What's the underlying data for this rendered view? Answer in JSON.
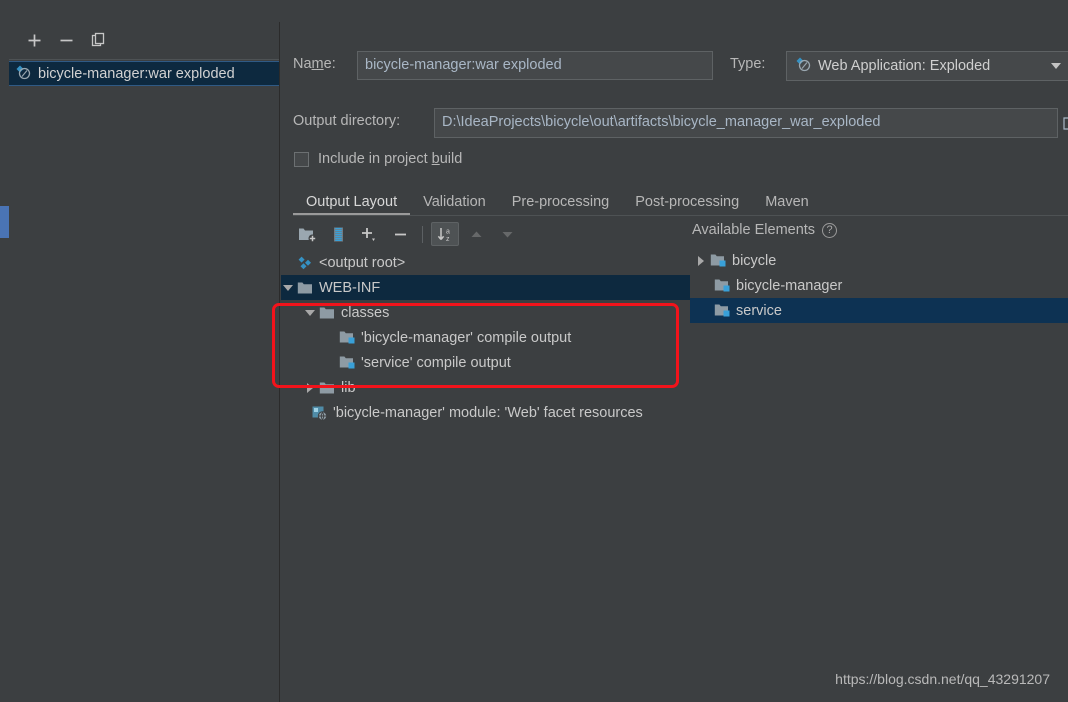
{
  "window": {
    "close_glyph": "✕"
  },
  "sidebar": {
    "toolbar": [
      {
        "name": "add-artifact-button",
        "label": "+"
      },
      {
        "name": "remove-artifact-button",
        "label": "−"
      },
      {
        "name": "copy-artifact-button",
        "label": "copy-icon"
      }
    ],
    "items": [
      {
        "label": "bicycle-manager:war exploded",
        "icon": "artifact-icon",
        "selected": true
      }
    ]
  },
  "form": {
    "name_label_pre": "Na",
    "name_label_mnemonic": "m",
    "name_label_post": "e:",
    "name_value": "bicycle-manager:war exploded",
    "type_label": "Type:",
    "type_value": "Web Application: Exploded",
    "type_icon": "artifact-icon",
    "outdir_label": "Output directory:",
    "outdir_value": "D:\\IdeaProjects\\bicycle\\out\\artifacts\\bicycle_manager_war_exploded",
    "outdir_browse_icon": "folder-open-icon",
    "include_label_pre": "Include in project ",
    "include_label_mnemonic": "b",
    "include_label_post": "uild",
    "include_checked": false
  },
  "tabs": [
    {
      "label": "Output Layout",
      "active": true
    },
    {
      "label": "Validation",
      "active": false
    },
    {
      "label": "Pre-processing",
      "active": false
    },
    {
      "label": "Post-processing",
      "active": false
    },
    {
      "label": "Maven",
      "active": false
    }
  ],
  "content_toolbar": [
    {
      "name": "create-directory-button",
      "icon": "folder-add-icon",
      "state": "normal"
    },
    {
      "name": "create-archive-button",
      "icon": "archive-icon",
      "state": "normal"
    },
    {
      "name": "add-copy-of-button",
      "icon": "plus-dropdown-icon",
      "state": "normal"
    },
    {
      "name": "remove-element-button",
      "icon": "minus-icon",
      "state": "normal"
    },
    {
      "name": "separator",
      "icon": "separator",
      "state": "separator"
    },
    {
      "name": "sort-alphabetically-button",
      "icon": "sort-az-icon",
      "state": "toggled"
    },
    {
      "name": "move-up-button",
      "icon": "arrow-up-icon",
      "state": "disabled"
    },
    {
      "name": "move-down-button",
      "icon": "arrow-down-icon",
      "state": "disabled"
    }
  ],
  "output_tree": [
    {
      "label": "<output root>",
      "icon": "artifact-icon",
      "indent": 0,
      "arrow": "none",
      "selected": false
    },
    {
      "label": "WEB-INF",
      "icon": "folder-icon",
      "indent": 0,
      "arrow": "down",
      "selected": true
    },
    {
      "label": "classes",
      "icon": "folder-icon",
      "indent": 1,
      "arrow": "down",
      "selected": false
    },
    {
      "label": "'bicycle-manager' compile output",
      "icon": "module-output-icon",
      "indent": 2,
      "arrow": "none",
      "selected": false
    },
    {
      "label": "'service' compile output",
      "icon": "module-output-icon",
      "indent": 2,
      "arrow": "none",
      "selected": false
    },
    {
      "label": "lib",
      "icon": "folder-icon",
      "indent": 1,
      "arrow": "right",
      "selected": false
    },
    {
      "label": "'bicycle-manager' module: 'Web' facet resources",
      "icon": "web-facet-icon",
      "indent": 1,
      "arrow": "none",
      "selected": false
    }
  ],
  "available": {
    "title": "Available Elements",
    "help_icon": "help-icon",
    "help_glyph": "?",
    "items": [
      {
        "label": "bicycle",
        "icon": "module-output-icon",
        "arrow": "right",
        "selected": false
      },
      {
        "label": "bicycle-manager",
        "icon": "module-output-icon",
        "arrow": "none",
        "selected": false
      },
      {
        "label": "service",
        "icon": "module-output-icon",
        "arrow": "none",
        "selected": true
      }
    ]
  },
  "annotation": {
    "type": "red-rectangle",
    "color": "#f2131b"
  },
  "watermark": "https://blog.csdn.net/qq_43291207",
  "colors": {
    "background": "#3c3f41",
    "field_background": "#45484a",
    "selection": "#0d293f",
    "selection_strong": "#0d3253",
    "accent_blue": "#4a74b5",
    "text": "#bbbbbb",
    "annotation_red": "#f2131b"
  }
}
